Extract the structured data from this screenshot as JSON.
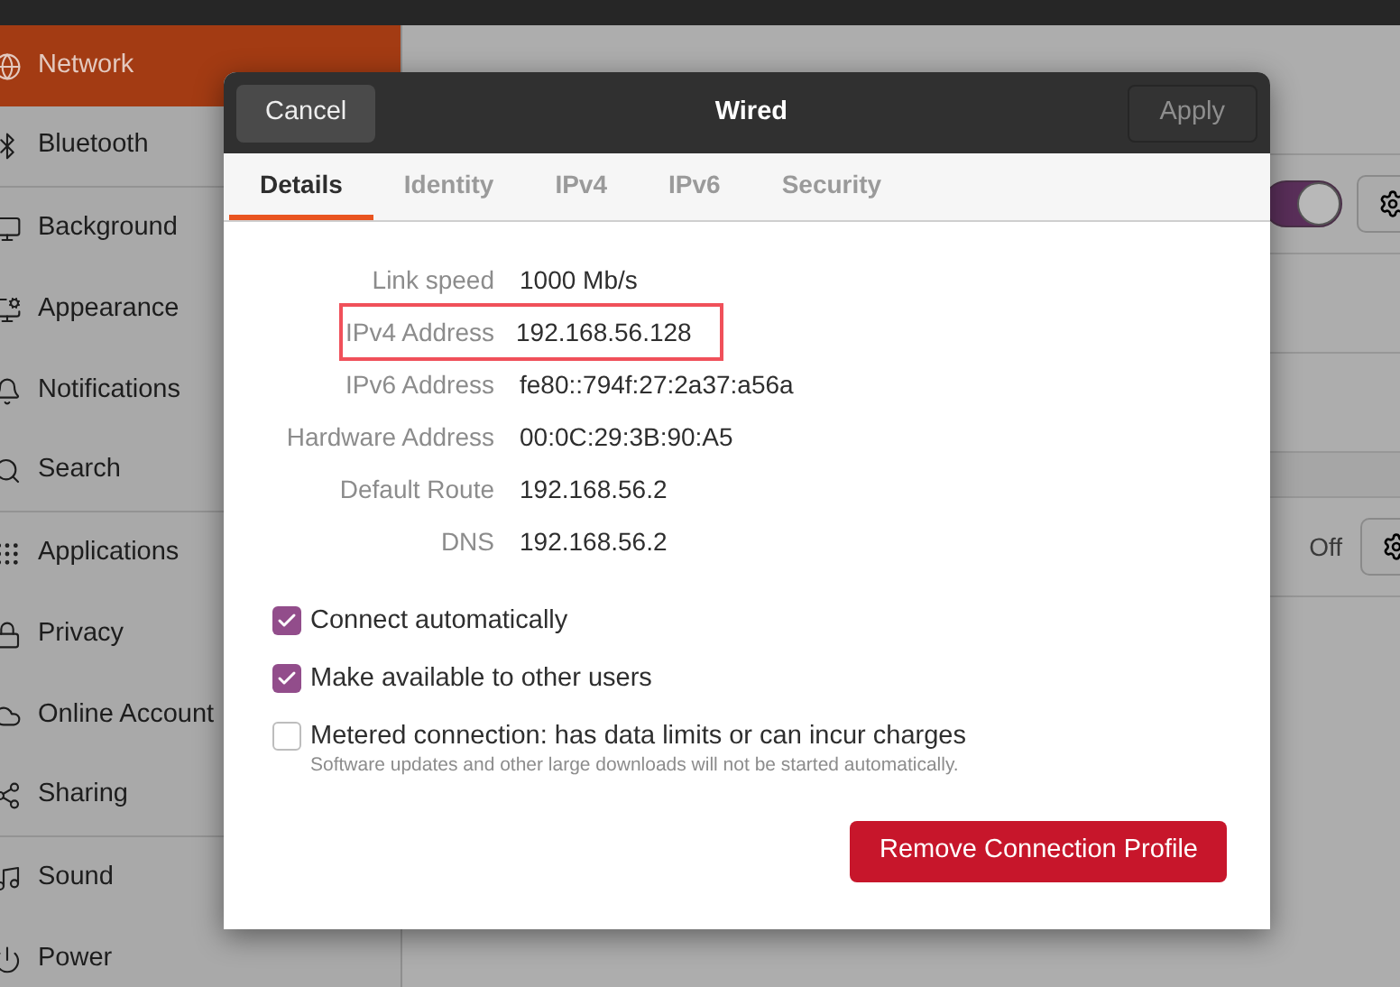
{
  "sidebar": {
    "items": [
      {
        "label": "Network",
        "selected": true
      },
      {
        "label": "Bluetooth",
        "selected": false
      },
      {
        "label": "Background",
        "selected": false
      },
      {
        "label": "Appearance",
        "selected": false
      },
      {
        "label": "Notifications",
        "selected": false
      },
      {
        "label": "Search",
        "selected": false
      },
      {
        "label": "Applications",
        "selected": false
      },
      {
        "label": "Privacy",
        "selected": false
      },
      {
        "label": "Online Account",
        "selected": false
      },
      {
        "label": "Sharing",
        "selected": false
      },
      {
        "label": "Sound",
        "selected": false
      },
      {
        "label": "Power",
        "selected": false
      }
    ]
  },
  "panel": {
    "wired_switch": {
      "on": true
    },
    "proxy_status": "Off"
  },
  "dialog": {
    "title": "Wired",
    "cancel": "Cancel",
    "apply": {
      "label": "Apply",
      "disabled": true
    },
    "tabs": [
      {
        "label": "Details",
        "selected": true
      },
      {
        "label": "Identity",
        "selected": false
      },
      {
        "label": "IPv4",
        "selected": false
      },
      {
        "label": "IPv6",
        "selected": false
      },
      {
        "label": "Security",
        "selected": false
      }
    ],
    "details": [
      {
        "label": "Link speed",
        "value": "1000 Mb/s",
        "highlighted": false
      },
      {
        "label": "IPv4 Address",
        "value": "192.168.56.128",
        "highlighted": true
      },
      {
        "label": "IPv6 Address",
        "value": "fe80::794f:27:2a37:a56a",
        "highlighted": false
      },
      {
        "label": "Hardware Address",
        "value": "00:0C:29:3B:90:A5",
        "highlighted": false
      },
      {
        "label": "Default Route",
        "value": "192.168.56.2",
        "highlighted": false
      },
      {
        "label": "DNS",
        "value": "192.168.56.2",
        "highlighted": false
      }
    ],
    "options": [
      {
        "label": "Connect automatically",
        "checked": true
      },
      {
        "label": "Make available to other users",
        "checked": true
      },
      {
        "label": "Metered connection: has data limits or can incur charges",
        "checked": false,
        "hint": "Software updates and other large downloads will not be started automatically."
      }
    ],
    "remove": "Remove Connection Profile"
  }
}
